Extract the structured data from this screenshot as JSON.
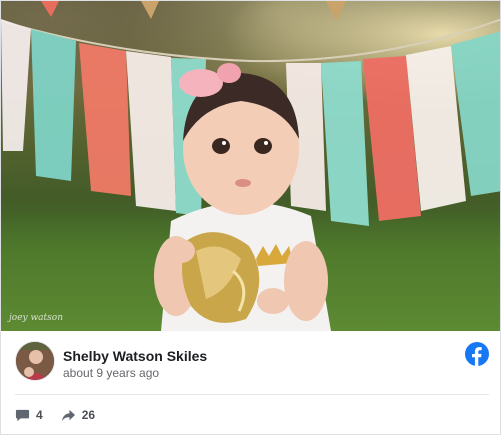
{
  "post": {
    "author": "Shelby Watson Skiles",
    "timestamp": "about 9 years ago",
    "photo_watermark": "joey watson"
  },
  "stats": {
    "comments": "4",
    "shares": "26"
  },
  "icons": {
    "platform": "facebook-icon",
    "comments": "comment-icon",
    "shares": "share-arrow-icon"
  },
  "colors": {
    "facebook_blue": "#1877f2",
    "muted_text": "#65676b",
    "stat_text": "#4b4f56"
  }
}
